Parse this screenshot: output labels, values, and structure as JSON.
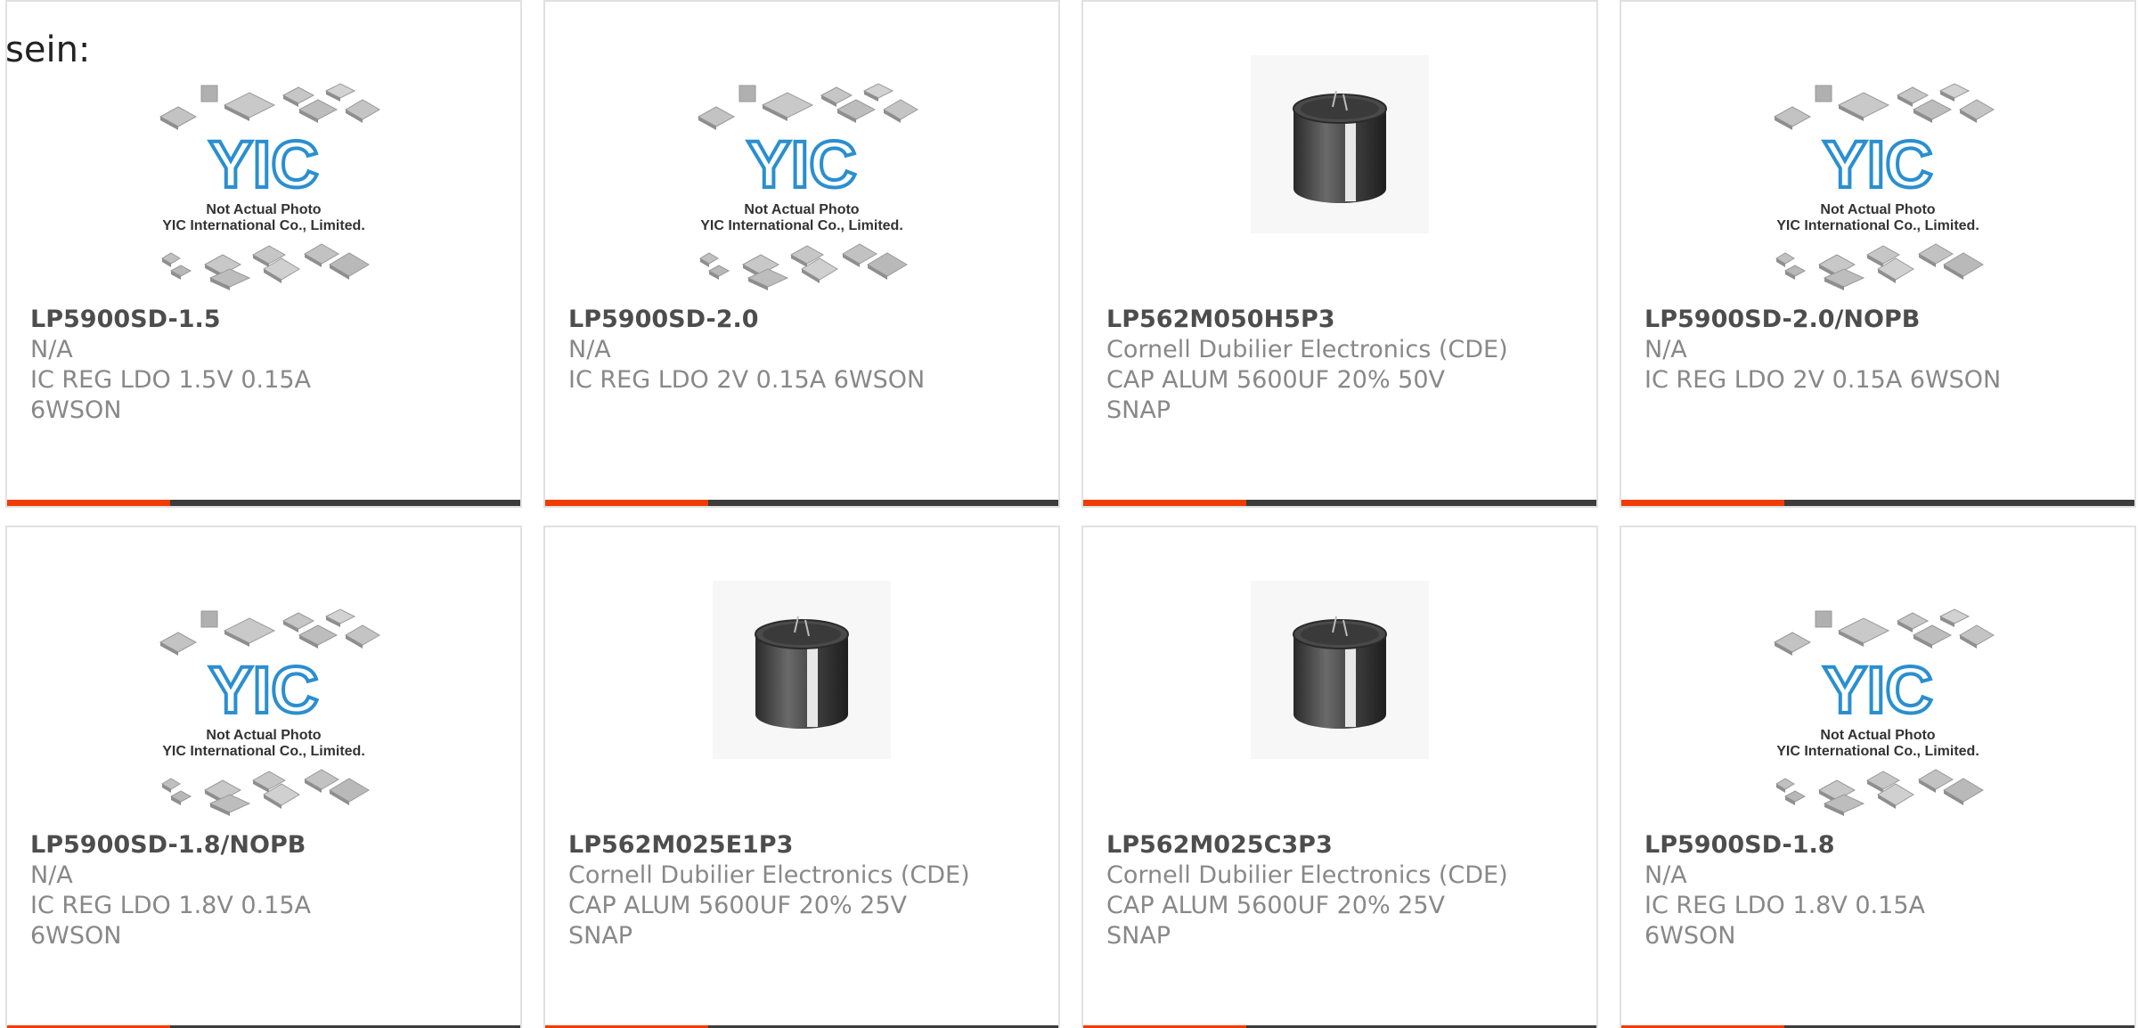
{
  "intro_text": "sein:",
  "colors": {
    "accent": "#f03c00",
    "bar_dark": "#3c3c3c",
    "logo_blue": "#2a8fd0",
    "card_border": "#e1e1e1"
  },
  "placeholder": {
    "logo_text": "YIC",
    "line1": "Not Actual Photo",
    "line2": "YIC International Co., Limited."
  },
  "products": [
    {
      "part_number": "LP5900SD-1.5",
      "manufacturer": "N/A",
      "description": "IC REG LDO 1.5V 0.15A 6WSON",
      "image": "placeholder-photo"
    },
    {
      "part_number": "LP5900SD-2.0",
      "manufacturer": "N/A",
      "description": "IC REG LDO 2V 0.15A 6WSON",
      "image": "placeholder-photo"
    },
    {
      "part_number": "LP562M050H5P3",
      "manufacturer": "Cornell Dubilier Electronics (CDE)",
      "description": "CAP ALUM 5600UF 20% 50V SNAP",
      "image": "capacitor-photo"
    },
    {
      "part_number": "LP5900SD-2.0/NOPB",
      "manufacturer": "N/A",
      "description": "IC REG LDO 2V 0.15A 6WSON",
      "image": "placeholder-photo"
    },
    {
      "part_number": "LP5900SD-1.8/NOPB",
      "manufacturer": "N/A",
      "description": "IC REG LDO 1.8V 0.15A 6WSON",
      "image": "placeholder-photo"
    },
    {
      "part_number": "LP562M025E1P3",
      "manufacturer": "Cornell Dubilier Electronics (CDE)",
      "description": "CAP ALUM 5600UF 20% 25V SNAP",
      "image": "capacitor-photo"
    },
    {
      "part_number": "LP562M025C3P3",
      "manufacturer": "Cornell Dubilier Electronics (CDE)",
      "description": "CAP ALUM 5600UF 20% 25V SNAP",
      "image": "capacitor-photo"
    },
    {
      "part_number": "LP5900SD-1.8",
      "manufacturer": "N/A",
      "description": "IC REG LDO 1.8V 0.15A 6WSON",
      "image": "placeholder-photo"
    }
  ]
}
